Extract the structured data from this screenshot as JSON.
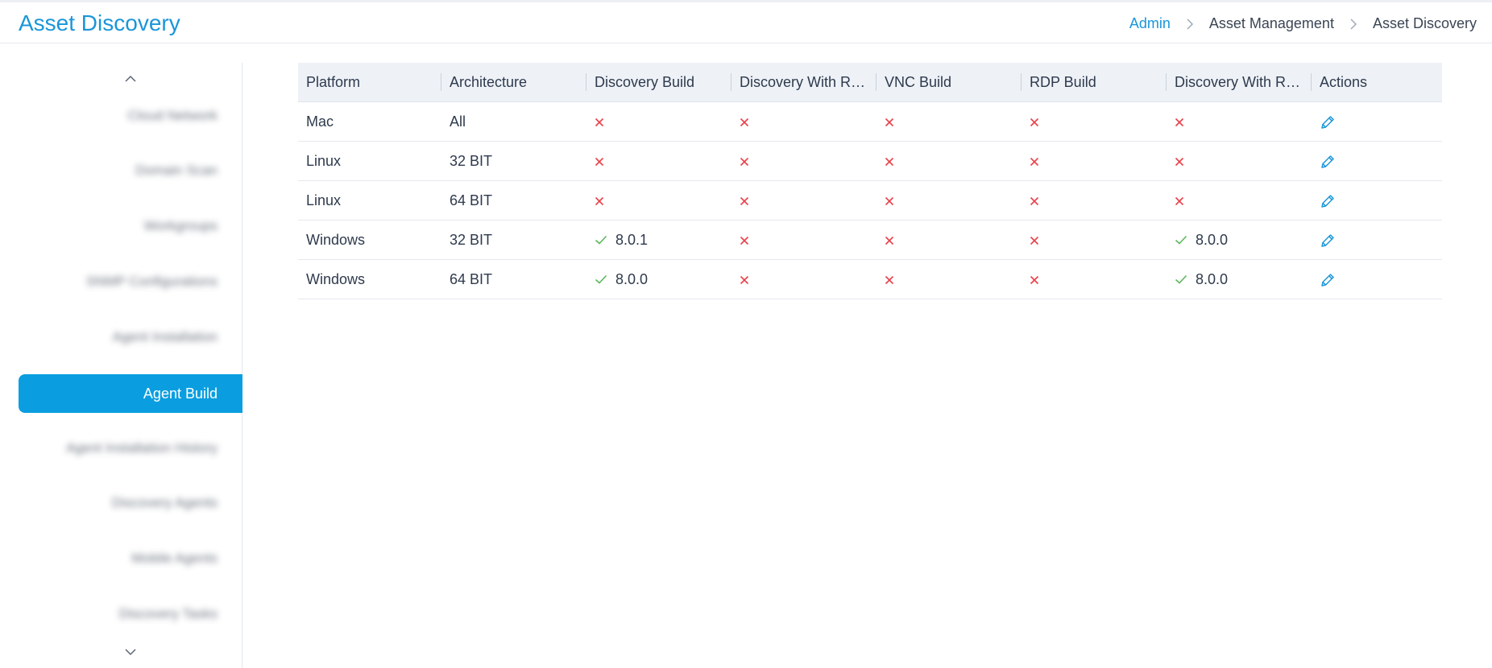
{
  "header": {
    "title": "Asset Discovery",
    "breadcrumb": [
      "Admin",
      "Asset Management",
      "Asset Discovery"
    ]
  },
  "sidebar": {
    "blurred_items": [
      "",
      "",
      "",
      "",
      "",
      "",
      "",
      "",
      ""
    ],
    "active_item": "Agent Build"
  },
  "table": {
    "columns": [
      "Platform",
      "Architecture",
      "Discovery Build",
      "Discovery With R…",
      "VNC Build",
      "RDP Build",
      "Discovery With R…",
      "Actions"
    ],
    "rows": [
      {
        "platform": "Mac",
        "architecture": "All",
        "discovery_build": "",
        "discovery_with_r1": "",
        "vnc_build": "",
        "rdp_build": "",
        "discovery_with_r2": ""
      },
      {
        "platform": "Linux",
        "architecture": "32 BIT",
        "discovery_build": "",
        "discovery_with_r1": "",
        "vnc_build": "",
        "rdp_build": "",
        "discovery_with_r2": ""
      },
      {
        "platform": "Linux",
        "architecture": "64 BIT",
        "discovery_build": "",
        "discovery_with_r1": "",
        "vnc_build": "",
        "rdp_build": "",
        "discovery_with_r2": ""
      },
      {
        "platform": "Windows",
        "architecture": "32 BIT",
        "discovery_build": "8.0.1",
        "discovery_with_r1": "",
        "vnc_build": "",
        "rdp_build": "",
        "discovery_with_r2": "8.0.0"
      },
      {
        "platform": "Windows",
        "architecture": "64 BIT",
        "discovery_build": "8.0.0",
        "discovery_with_r1": "",
        "vnc_build": "",
        "rdp_build": "",
        "discovery_with_r2": "8.0.0"
      }
    ]
  },
  "colors": {
    "accent": "#1a96d8",
    "active_bg": "#0a9ee0",
    "cross": "#e8414a",
    "check": "#5cb85c",
    "header_bg": "#eef2f7"
  },
  "icons": {
    "sidebar_up": "chevron-up-icon",
    "sidebar_down": "chevron-down-icon",
    "breadcrumb_separator": "chevron-right-icon",
    "not_available": "cross-icon",
    "available": "check-icon",
    "edit": "pencil-icon"
  }
}
